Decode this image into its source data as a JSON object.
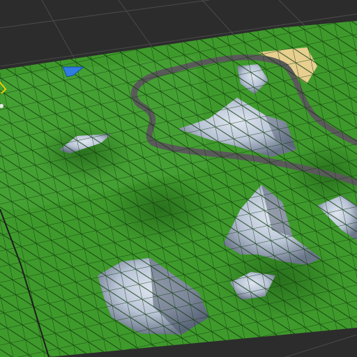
{
  "scene": {
    "view": "3d-scene-view",
    "background_color": "#2c2c2c",
    "grid_line_color": "#4a4a4a",
    "terrain": {
      "base_color": "#3f9a2c",
      "shadow_color": "#1f5e16",
      "wireframe_color": "#0f3a0c",
      "rock_color": "#b9c4d6",
      "rock_shadow_color": "#6b768a",
      "path_color": "#5a5a5a",
      "sand_color": "#e7cf8f",
      "wireframe": true
    },
    "gizmo": {
      "icon": "camera-direction-icon",
      "color": "#2f7de1"
    },
    "selection_outline": {
      "color": "#f0d000"
    }
  }
}
